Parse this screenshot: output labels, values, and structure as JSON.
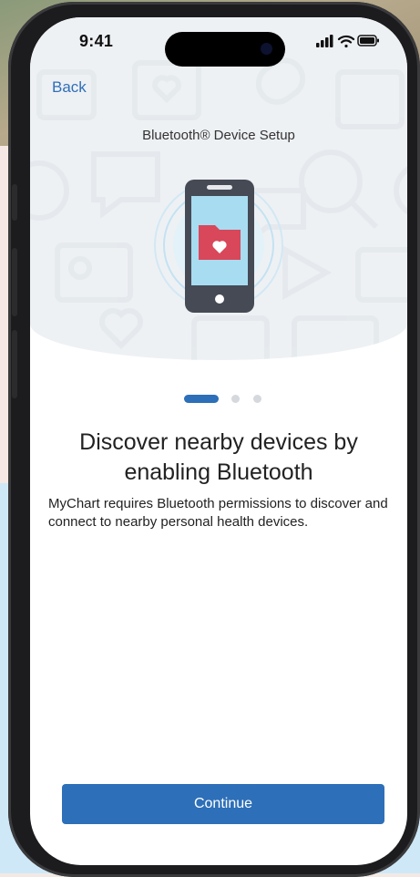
{
  "status_bar": {
    "time": "9:41",
    "icons": [
      "cellular-signal-icon",
      "wifi-icon",
      "battery-icon"
    ]
  },
  "nav": {
    "back_label": "Back"
  },
  "page": {
    "title": "Bluetooth® Device Setup",
    "hero_icon": "phone-with-health-folder-icon",
    "heading": "Discover nearby devices by enabling Bluetooth",
    "body": "MyChart requires Bluetooth permissions to discover and connect to nearby personal health devices."
  },
  "pager": {
    "current": 1,
    "total": 3
  },
  "actions": {
    "continue_label": "Continue"
  },
  "colors": {
    "accent": "#2d6fb8",
    "header_bg": "#eef1f4",
    "phone_screen": "#a8dcf1",
    "folder": "#d9475a"
  }
}
